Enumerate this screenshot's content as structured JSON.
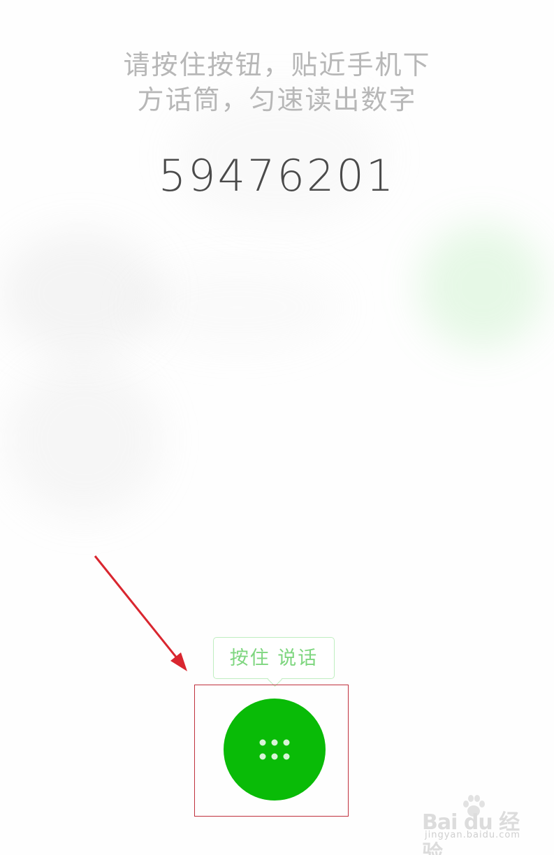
{
  "instruction": {
    "line1": "请按住按钮，贴近手机下",
    "line2": "方话筒，匀速读出数字"
  },
  "digits": "59476201",
  "talk_button": {
    "tooltip": "按住 说话",
    "icon": "keypad-dots-icon"
  },
  "watermark": {
    "brand": "Bai du 经验",
    "url": "jingyan.baidu.com"
  },
  "colors": {
    "accent_green": "#09bb07",
    "tooltip_text": "#7ed67f",
    "tooltip_border": "#bfeec0",
    "annotation_red": "#d9262f",
    "instruction_text": "#b7b7b7",
    "digits_text": "#4a4a4a"
  }
}
